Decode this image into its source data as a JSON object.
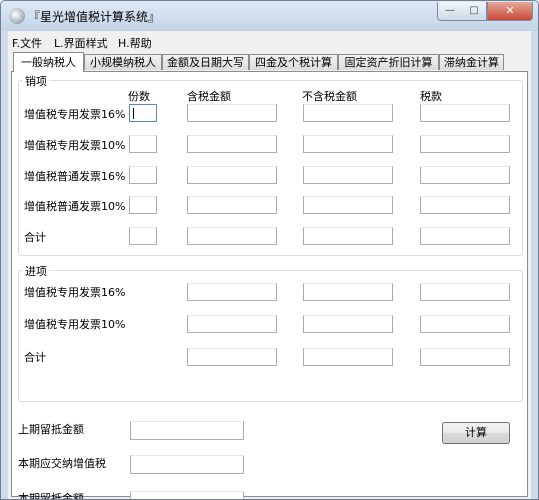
{
  "window": {
    "title": "『星光增值税计算系统』",
    "minimize_glyph": "—",
    "maximize_glyph": "□",
    "close_glyph": "✕"
  },
  "menu": [
    {
      "label": "F.文件"
    },
    {
      "label": "L.界面样式"
    },
    {
      "label": "H.帮助"
    }
  ],
  "tabs": [
    {
      "label": "一般纳税人",
      "active": true
    },
    {
      "label": "小规模纳税人"
    },
    {
      "label": "金额及日期大写"
    },
    {
      "label": "四金及个税计算"
    },
    {
      "label": "固定资产折旧计算"
    },
    {
      "label": "滞纳金计算"
    }
  ],
  "sales": {
    "title": "销项",
    "headers": {
      "count": "份数",
      "with_tax": "含税金额",
      "without_tax": "不含税金额",
      "tax": "税款"
    },
    "rows": [
      {
        "label": "增值税专用发票16%"
      },
      {
        "label": "增值税专用发票10%"
      },
      {
        "label": "增值税普通发票16%"
      },
      {
        "label": "增值税普通发票10%"
      },
      {
        "label": "合计"
      }
    ]
  },
  "purchase": {
    "title": "进项",
    "rows": [
      {
        "label": "增值税专用发票16%"
      },
      {
        "label": "增值税专用发票10%"
      },
      {
        "label": "合计"
      }
    ]
  },
  "summary": {
    "prev_credit": "上期留抵金额",
    "current_vat_due": "本期应交纳增值税",
    "current_credit": "本期留抵金额"
  },
  "buttons": {
    "calculate": "计算"
  }
}
